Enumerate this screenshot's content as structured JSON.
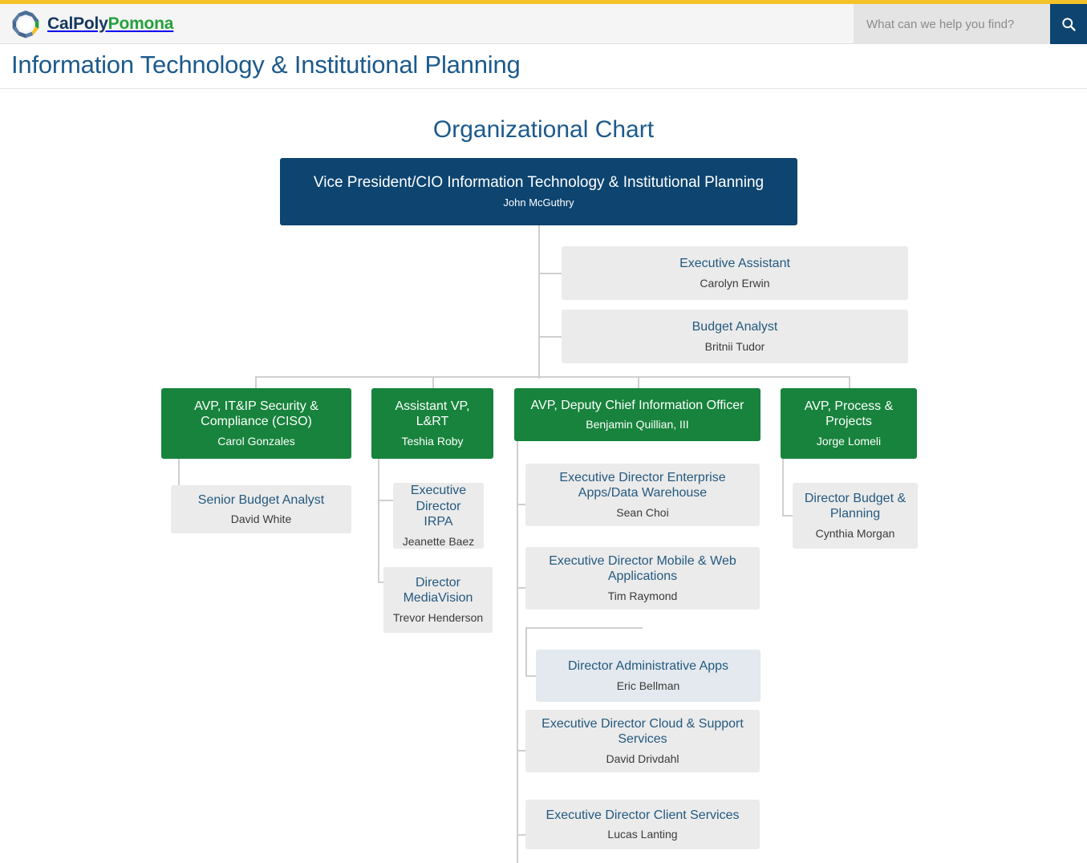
{
  "header": {
    "brand_first": "CalPoly",
    "brand_second": "Pomona",
    "brand_logo_icon": "calpoly-hexagon-logo",
    "search_placeholder": "What can we help you find?",
    "search_value": "",
    "search_icon": "search-icon"
  },
  "page": {
    "title": "Information Technology & Institutional Planning",
    "chart_heading": "Organizational Chart"
  },
  "colors": {
    "accent_yellow": "#f3c228",
    "brand_blue": "#14375e",
    "brand_green": "#27a03c",
    "root_box": "#0d4470",
    "exec_box": "#17833c",
    "staff_box": "#ebebeb",
    "highlight_box": "#e3e9ee",
    "title_text": "#1c5a8c",
    "connector": "#cfcfcf"
  },
  "chart_data": {
    "type": "diagram",
    "title": "Organizational Chart",
    "nodes": [
      {
        "id": "vp-cio",
        "title": "Vice President/CIO Information Technology & Institutional Planning",
        "person": "John McGuthry",
        "level": 0,
        "style": "root"
      },
      {
        "id": "executive-assistant",
        "title": "Executive Assistant",
        "person": "Carolyn Erwin",
        "level": 1,
        "style": "staff",
        "parent": "vp-cio"
      },
      {
        "id": "budget-analyst",
        "title": "Budget Analyst",
        "person": "Britnii Tudor",
        "level": 1,
        "style": "staff",
        "parent": "vp-cio"
      },
      {
        "id": "avp-security-compliance",
        "title": "AVP, IT&IP Security & Compliance (CISO)",
        "person": "Carol Gonzales",
        "level": 1,
        "style": "exec",
        "parent": "vp-cio"
      },
      {
        "id": "senior-budget-analyst",
        "title": "Senior Budget Analyst",
        "person": "David White",
        "level": 2,
        "style": "staff",
        "parent": "avp-security-compliance"
      },
      {
        "id": "assistant-vp-lrt",
        "title": "Assistant VP, L&RT",
        "person": "Teshia Roby",
        "level": 1,
        "style": "exec",
        "parent": "vp-cio"
      },
      {
        "id": "exec-director-irpa",
        "title": "Executive Director IRPA",
        "person": "Jeanette Baez",
        "level": 2,
        "style": "staff",
        "parent": "assistant-vp-lrt"
      },
      {
        "id": "director-mediavision",
        "title": "Director MediaVision",
        "person": "Trevor Henderson",
        "level": 2,
        "style": "staff",
        "parent": "assistant-vp-lrt"
      },
      {
        "id": "avp-deputy-cio",
        "title": "AVP, Deputy Chief Information Officer",
        "person": "Benjamin Quillian, III",
        "level": 1,
        "style": "exec",
        "parent": "vp-cio"
      },
      {
        "id": "exec-director-enterprise-apps",
        "title": "Executive Director Enterprise Apps/Data Warehouse",
        "person": "Sean Choi",
        "level": 2,
        "style": "staff",
        "parent": "avp-deputy-cio"
      },
      {
        "id": "exec-director-mobile-web",
        "title": "Executive Director Mobile & Web Applications",
        "person": "Tim Raymond",
        "level": 2,
        "style": "staff",
        "parent": "avp-deputy-cio"
      },
      {
        "id": "director-administrative-apps",
        "title": "Director Administrative Apps",
        "person": "Eric Bellman",
        "level": 3,
        "style": "highlight",
        "parent": "exec-director-mobile-web"
      },
      {
        "id": "exec-director-cloud-support",
        "title": "Executive Director Cloud & Support Services",
        "person": "David Drivdahl",
        "level": 2,
        "style": "staff",
        "parent": "avp-deputy-cio"
      },
      {
        "id": "exec-director-client-services",
        "title": "Executive Director Client Services",
        "person": "Lucas Lanting",
        "level": 2,
        "style": "staff",
        "parent": "avp-deputy-cio"
      },
      {
        "id": "avp-process-projects",
        "title": "AVP, Process & Projects",
        "person": "Jorge Lomeli",
        "level": 1,
        "style": "exec",
        "parent": "vp-cio"
      },
      {
        "id": "director-budget-planning",
        "title": "Director Budget & Planning",
        "person": "Cynthia Morgan",
        "level": 2,
        "style": "staff",
        "parent": "avp-process-projects"
      }
    ]
  }
}
